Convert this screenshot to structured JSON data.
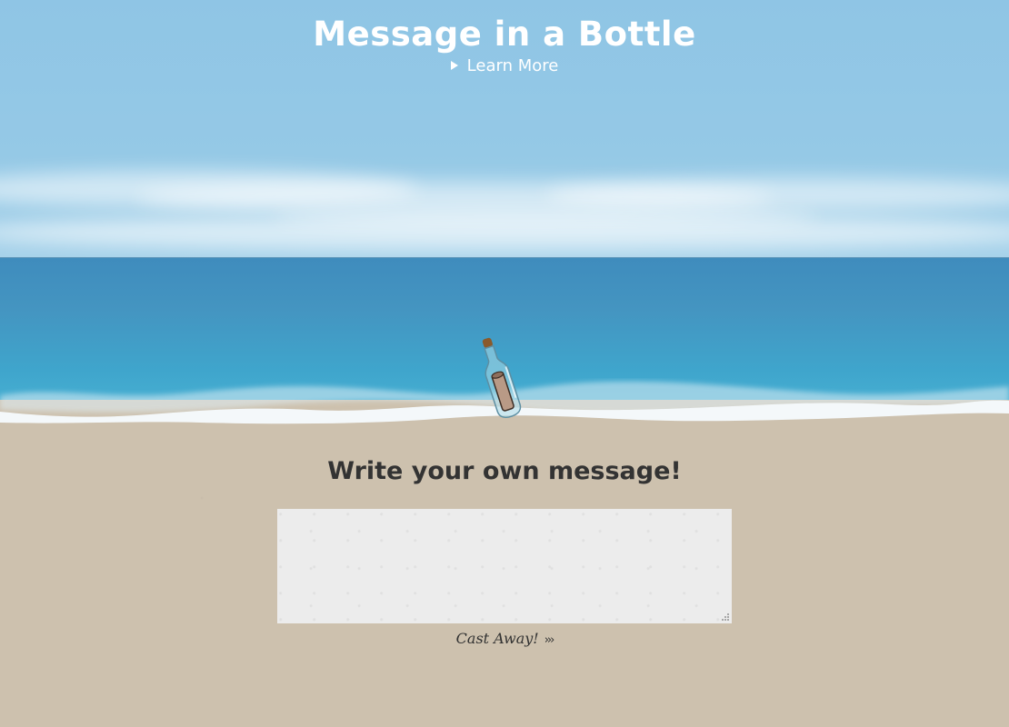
{
  "header": {
    "title": "Message in a Bottle",
    "learn_more": "Learn More"
  },
  "main": {
    "heading": "Write your own message!",
    "message_value": "",
    "message_placeholder": "",
    "cast_away_label": "Cast Away!",
    "cast_away_icon": "triple-chevron-right-icon"
  },
  "icons": {
    "learn_more": "play-triangle-icon",
    "bottle": "bottle-with-scroll",
    "resize": "resize-grip-icon"
  },
  "colors": {
    "sky": "#95c9e6",
    "sea": "#4495c1",
    "sand": "#cdc1ae",
    "heading_text": "#333333",
    "title_text": "#ffffff"
  }
}
